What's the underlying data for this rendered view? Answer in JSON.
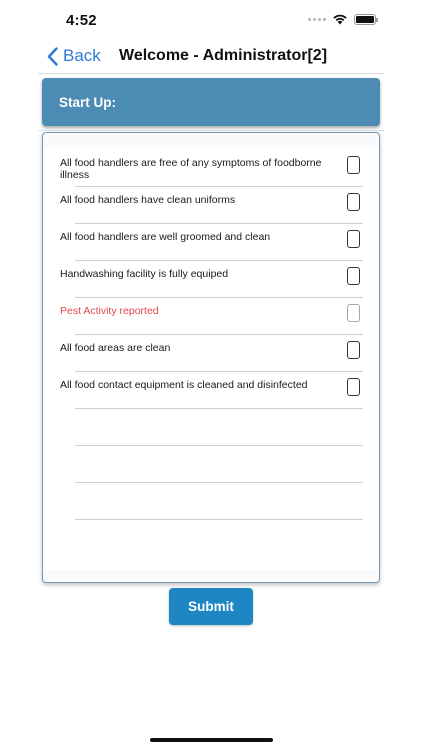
{
  "status_bar": {
    "time": "4:52",
    "icons": [
      "cellular-signal-icon",
      "wifi-icon",
      "battery-icon"
    ]
  },
  "nav": {
    "back_label": "Back",
    "title": "Welcome - Administrator[2]"
  },
  "section": {
    "title": "Start Up:"
  },
  "checklist": {
    "items": [
      {
        "label": "All food handlers are free of any symptoms of foodborne illness",
        "checked": false,
        "alert": false
      },
      {
        "label": "All food handlers have clean uniforms",
        "checked": false,
        "alert": false
      },
      {
        "label": "All food handlers are well groomed and clean",
        "checked": false,
        "alert": false
      },
      {
        "label": "Handwashing facility is fully equiped",
        "checked": false,
        "alert": false
      },
      {
        "label": "Pest Activity reported",
        "checked": false,
        "alert": true
      },
      {
        "label": "All food areas are clean",
        "checked": false,
        "alert": false
      },
      {
        "label": "All food contact equipment is cleaned and disinfected",
        "checked": false,
        "alert": false
      }
    ]
  },
  "submit_label": "Submit",
  "colors": {
    "accent_blue": "#2f7ad6",
    "header_blue": "#4b8bb4",
    "submit_blue": "#1f86c4",
    "alert_red": "#e0474c"
  }
}
